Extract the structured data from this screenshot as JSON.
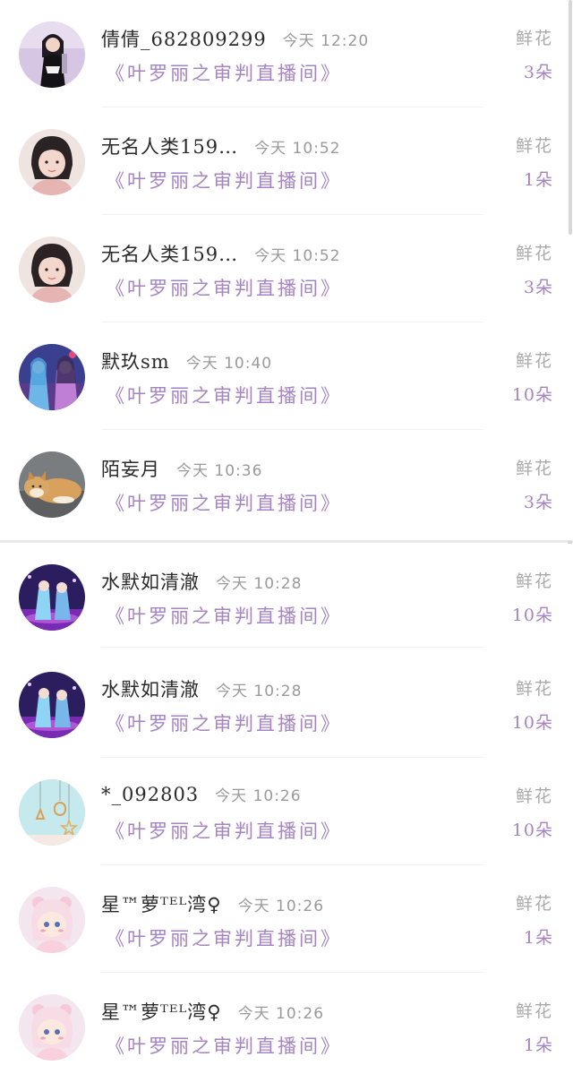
{
  "gift_records": [
    {
      "user": "倩倩_682809299",
      "time": "今天 12:20",
      "room": "《叶罗丽之审判直播间》",
      "gift_label": "鲜花",
      "gift_count": "3朵",
      "avatar": "girl-photo-avatar"
    },
    {
      "user": "无名人类159…",
      "time": "今天 10:52",
      "room": "《叶罗丽之审判直播间》",
      "gift_label": "鲜花",
      "gift_count": "1朵",
      "avatar": "child-photo-avatar"
    },
    {
      "user": "无名人类159…",
      "time": "今天 10:52",
      "room": "《叶罗丽之审判直播间》",
      "gift_label": "鲜花",
      "gift_count": "3朵",
      "avatar": "child-photo-avatar"
    },
    {
      "user": "默玖sm",
      "time": "今天 10:40",
      "room": "《叶罗丽之审判直播间》",
      "gift_label": "鲜花",
      "gift_count": "10朵",
      "avatar": "anime-duo-avatar"
    },
    {
      "user": "陌妄月",
      "time": "今天 10:36",
      "room": "《叶罗丽之审判直播间》",
      "gift_label": "鲜花",
      "gift_count": "3朵",
      "avatar": "cat-photo-avatar"
    },
    {
      "user": "水默如清澈",
      "time": "今天 10:28",
      "room": "《叶罗丽之审判直播间》",
      "gift_label": "鲜花",
      "gift_count": "10朵",
      "avatar": "anime-stage-avatar"
    },
    {
      "user": "水默如清澈",
      "time": "今天 10:28",
      "room": "《叶罗丽之审判直播间》",
      "gift_label": "鲜花",
      "gift_count": "10朵",
      "avatar": "anime-stage-avatar"
    },
    {
      "user": "*_092803",
      "time": "今天 10:26",
      "room": "《叶罗丽之审判直播间》",
      "gift_label": "鲜花",
      "gift_count": "10朵",
      "avatar": "star-charm-avatar"
    },
    {
      "user": "星™萝ᵀᴱᴸ湾♀",
      "time": "今天 10:26",
      "room": "《叶罗丽之审判直播间》",
      "gift_label": "鲜花",
      "gift_count": "1朵",
      "avatar": "chibi-girl-avatar"
    },
    {
      "user": "星™萝ᵀᴱᴸ湾♀",
      "time": "今天 10:26",
      "room": "《叶罗丽之审判直播间》",
      "gift_label": "鲜花",
      "gift_count": "1朵",
      "avatar": "chibi-girl-avatar"
    }
  ],
  "colors": {
    "room_text": "#a684c4",
    "name_text": "#2a2a2a",
    "muted_text": "#9a9a9a"
  }
}
